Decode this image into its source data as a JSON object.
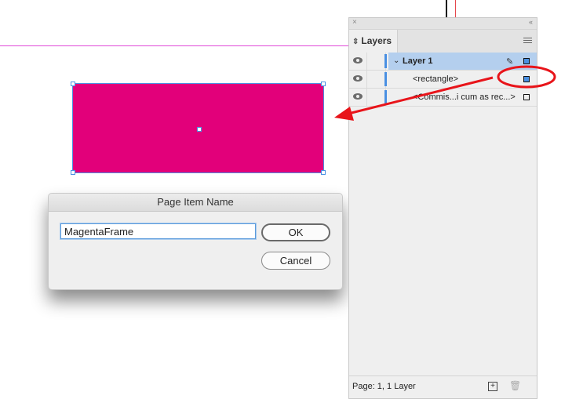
{
  "canvas": {
    "frame_color": "#e2007a",
    "selection_color": "#4a90e2",
    "margin_guide_color": "#e04ad8"
  },
  "dialog": {
    "title": "Page Item Name",
    "name_value": "MagentaFrame",
    "ok_label": "OK",
    "cancel_label": "Cancel"
  },
  "layers_panel": {
    "close_glyph": "×",
    "collapse_glyph": "‹‹",
    "tab_label": "Layers",
    "tab_icon": "⇕",
    "rows": [
      {
        "label": "Layer 1",
        "type": "layer",
        "selected": true,
        "expanded": true,
        "chevron": "⌄",
        "pen_icon": "✎"
      },
      {
        "label": "<rectangle>",
        "type": "item",
        "selected_in_layer": true
      },
      {
        "label": "<Commis...i cum as rec...>",
        "type": "item",
        "selected_in_layer": false
      }
    ],
    "footer": {
      "status": "Page: 1, 1 Layer",
      "new_layer_glyph": "+",
      "trash_glyph": "🗑"
    }
  },
  "annotation": {
    "color": "#e8141a",
    "description": "Red ellipse around rectangle's selection square with arrow pointing to the frame"
  }
}
